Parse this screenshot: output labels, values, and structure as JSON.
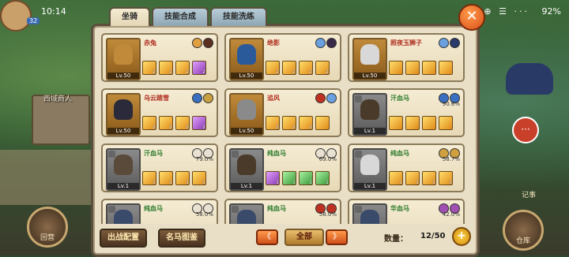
{
  "status": {
    "time": "10:14",
    "battery": "92",
    "icons": "✉ ⊕ ☰ ···"
  },
  "player": {
    "level": "32"
  },
  "tabs": [
    {
      "label": "坐骑",
      "active": true
    },
    {
      "label": "技能合成",
      "active": false
    },
    {
      "label": "技能洗练",
      "active": false
    }
  ],
  "close_label": "✕",
  "cards": [
    {
      "name": "赤兔",
      "level": "Lv.50",
      "pct": "",
      "portrait_color": "#c08a3a",
      "attr_colors": [
        "#e0a040",
        "#5a3020"
      ],
      "skills": [
        "2",
        "2",
        "2",
        "2"
      ],
      "skill_types": [
        "gold",
        "gold",
        "gold",
        "purple"
      ]
    },
    {
      "name": "绝影",
      "level": "Lv.50",
      "pct": "",
      "portrait_color": "#2a5a9a",
      "attr_colors": [
        "#6aa0e0",
        "#3a2a4a"
      ],
      "skills": [
        "2",
        "2",
        "2",
        "2"
      ],
      "skill_types": [
        "gold",
        "gold",
        "gold",
        "gold"
      ]
    },
    {
      "name": "照夜玉狮子",
      "level": "Lv.50",
      "pct": "",
      "portrait_color": "#d8d8d8",
      "attr_colors": [
        "#6aa0e0",
        "#2a3a6a"
      ],
      "skills": [
        "",
        "",
        "",
        ""
      ],
      "skill_types": [
        "gold",
        "gold",
        "gold",
        "gold"
      ]
    },
    {
      "name": "乌云踏雪",
      "level": "Lv.50",
      "pct": "",
      "portrait_color": "#2a2a3a",
      "attr_colors": [
        "#3a70c0",
        "#c8a040"
      ],
      "skills": [
        "2",
        "2",
        "2",
        "2"
      ],
      "skill_types": [
        "gold",
        "gold",
        "gold",
        "purple"
      ]
    },
    {
      "name": "追风",
      "level": "Lv.50",
      "pct": "",
      "portrait_color": "#8a8a8a",
      "attr_colors": [
        "#c03020",
        "#6aa0e0"
      ],
      "skills": [
        "2",
        "2",
        "2",
        ""
      ],
      "skill_types": [
        "gold",
        "gold",
        "gold",
        "gold"
      ]
    },
    {
      "name": "汗血马",
      "level": "Lv.1",
      "pct": "90.6%",
      "portrait_color": "#4a3a2a",
      "attr_colors": [
        "#3a70c0",
        "#3a70c0"
      ],
      "skills": [
        "",
        "",
        "",
        ""
      ],
      "skill_types": [
        "gold",
        "gold",
        "gold",
        "gold"
      ]
    },
    {
      "name": "汗血马",
      "level": "Lv.1",
      "pct": "79.0%",
      "portrait_color": "#5a4a3a",
      "attr_colors": [
        "#e8e0d0",
        "#e8e0d0"
      ],
      "skills": [
        "1",
        "1",
        "1",
        "1"
      ],
      "skill_types": [
        "gold",
        "gold",
        "gold",
        "gold"
      ]
    },
    {
      "name": "纯血马",
      "level": "Lv.1",
      "pct": "69.0%",
      "portrait_color": "#4a3a2a",
      "attr_colors": [
        "#e8e0d0",
        "#e8e0d0"
      ],
      "skills": [
        "1",
        "1",
        "1",
        "1"
      ],
      "skill_types": [
        "purple",
        "green",
        "green",
        "green"
      ]
    },
    {
      "name": "纯血马",
      "level": "Lv.1",
      "pct": "58.7%",
      "portrait_color": "#d8d8d8",
      "attr_colors": [
        "#d0a040",
        "#d0a040"
      ],
      "skills": [
        "1",
        "1",
        "1",
        "1"
      ],
      "skill_types": [
        "gold",
        "gold",
        "gold",
        "gold"
      ]
    },
    {
      "name": "纯血马",
      "level": "Lv.1",
      "pct": "58.0%",
      "portrait_color": "#3a4a6a",
      "attr_colors": [
        "#e8e0d0",
        "#e8e0d0"
      ],
      "skills": [
        "",
        "",
        "",
        ""
      ],
      "skill_types": [
        "gold",
        "gold",
        "gold",
        "gold"
      ]
    },
    {
      "name": "纯血马",
      "level": "Lv.1",
      "pct": "58.0%",
      "portrait_color": "#3a4a6a",
      "attr_colors": [
        "#c03020",
        "#c03020"
      ],
      "skills": [
        "",
        "",
        "",
        ""
      ],
      "skill_types": [
        "gold",
        "gold",
        "gold",
        "gold"
      ]
    },
    {
      "name": "华血马",
      "level": "Lv.1",
      "pct": "42.0%",
      "portrait_color": "#3a4a6a",
      "attr_colors": [
        "#a050b0",
        "#a050b0"
      ],
      "skills": [
        "",
        "",
        "",
        ""
      ],
      "skill_types": [
        "gold",
        "gold",
        "gold",
        "gold"
      ]
    }
  ],
  "bottom": {
    "deploy_label": "出战配置",
    "catalog_label": "名马图鉴",
    "filter_label": "全部",
    "prev_label": "《",
    "next_label": "》",
    "qty_label": "数量：",
    "qty_value": "12/50",
    "plus_label": "+"
  },
  "scene": {
    "shop_label": "西域商人",
    "camp_label": "回营",
    "warehouse_label": "仓库",
    "chat_label": "···",
    "side_note": "记事"
  },
  "colors": {
    "accent_orange": "#e06a20",
    "panel_bg": "#e9dfc6",
    "frame": "#5a4e3c"
  }
}
